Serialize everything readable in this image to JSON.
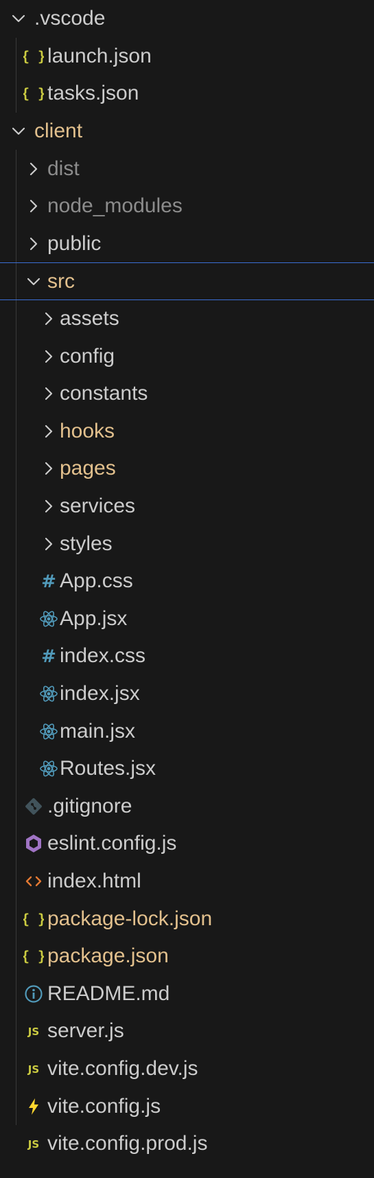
{
  "explorer": {
    "items": [
      {
        "label": ".vscode",
        "icon": "chevron-down-icon",
        "color": "normal",
        "interactable": true
      },
      {
        "label": "launch.json",
        "icon": "json-braces-icon",
        "color": "normal",
        "interactable": true
      },
      {
        "label": "tasks.json",
        "icon": "json-braces-icon",
        "color": "normal",
        "interactable": true
      },
      {
        "label": "client",
        "icon": "chevron-down-icon",
        "color": "yellow",
        "interactable": true
      },
      {
        "label": "dist",
        "icon": "chevron-right-icon",
        "color": "dim",
        "interactable": true
      },
      {
        "label": "node_modules",
        "icon": "chevron-right-icon",
        "color": "dim",
        "interactable": true
      },
      {
        "label": "public",
        "icon": "chevron-right-icon",
        "color": "normal",
        "interactable": true
      },
      {
        "label": "src",
        "icon": "chevron-down-icon",
        "color": "yellow",
        "interactable": true,
        "focused": true
      },
      {
        "label": "assets",
        "icon": "chevron-right-icon",
        "color": "normal",
        "interactable": true
      },
      {
        "label": "config",
        "icon": "chevron-right-icon",
        "color": "normal",
        "interactable": true
      },
      {
        "label": "constants",
        "icon": "chevron-right-icon",
        "color": "normal",
        "interactable": true
      },
      {
        "label": "hooks",
        "icon": "chevron-right-icon",
        "color": "yellow",
        "interactable": true
      },
      {
        "label": "pages",
        "icon": "chevron-right-icon",
        "color": "yellow",
        "interactable": true
      },
      {
        "label": "services",
        "icon": "chevron-right-icon",
        "color": "normal",
        "interactable": true
      },
      {
        "label": "styles",
        "icon": "chevron-right-icon",
        "color": "normal",
        "interactable": true
      },
      {
        "label": "App.css",
        "icon": "css-hash-icon",
        "color": "normal",
        "interactable": true
      },
      {
        "label": "App.jsx",
        "icon": "react-atom-icon",
        "color": "normal",
        "interactable": true
      },
      {
        "label": "index.css",
        "icon": "css-hash-icon",
        "color": "normal",
        "interactable": true
      },
      {
        "label": "index.jsx",
        "icon": "react-atom-icon",
        "color": "normal",
        "interactable": true
      },
      {
        "label": "main.jsx",
        "icon": "react-atom-icon",
        "color": "normal",
        "interactable": true
      },
      {
        "label": "Routes.jsx",
        "icon": "react-atom-icon",
        "color": "normal",
        "interactable": true
      },
      {
        "label": ".gitignore",
        "icon": "git-diamond-icon",
        "color": "normal",
        "interactable": true
      },
      {
        "label": "eslint.config.js",
        "icon": "eslint-hexagon-icon",
        "color": "normal",
        "interactable": true
      },
      {
        "label": "index.html",
        "icon": "html-brackets-icon",
        "color": "normal",
        "interactable": true
      },
      {
        "label": "package-lock.json",
        "icon": "json-braces-icon",
        "color": "yellow",
        "interactable": true
      },
      {
        "label": "package.json",
        "icon": "json-braces-icon",
        "color": "yellow",
        "interactable": true
      },
      {
        "label": "README.md",
        "icon": "info-circle-icon",
        "color": "normal",
        "interactable": true
      },
      {
        "label": "server.js",
        "icon": "javascript-js-icon",
        "color": "normal",
        "interactable": true
      },
      {
        "label": "vite.config.dev.js",
        "icon": "javascript-js-icon",
        "color": "normal",
        "interactable": true
      },
      {
        "label": "vite.config.js",
        "icon": "vite-bolt-icon",
        "color": "normal",
        "interactable": true
      },
      {
        "label": "vite.config.prod.js",
        "icon": "javascript-js-icon",
        "color": "normal",
        "interactable": true
      }
    ]
  },
  "colors": {
    "background": "#181818",
    "text_normal": "#cccccc",
    "text_dim": "#8c8c8c",
    "text_modified": "#e2c08d",
    "focus_border": "#3b6fd6",
    "json_icon": "#cbcb41",
    "css_icon": "#519aba",
    "react_icon": "#519aba",
    "git_icon": "#41535b",
    "eslint_icon": "#a074c4",
    "html_icon": "#e37933",
    "info_icon": "#519aba",
    "js_icon": "#cbcb41",
    "vite_icon": "#ffd62e"
  }
}
